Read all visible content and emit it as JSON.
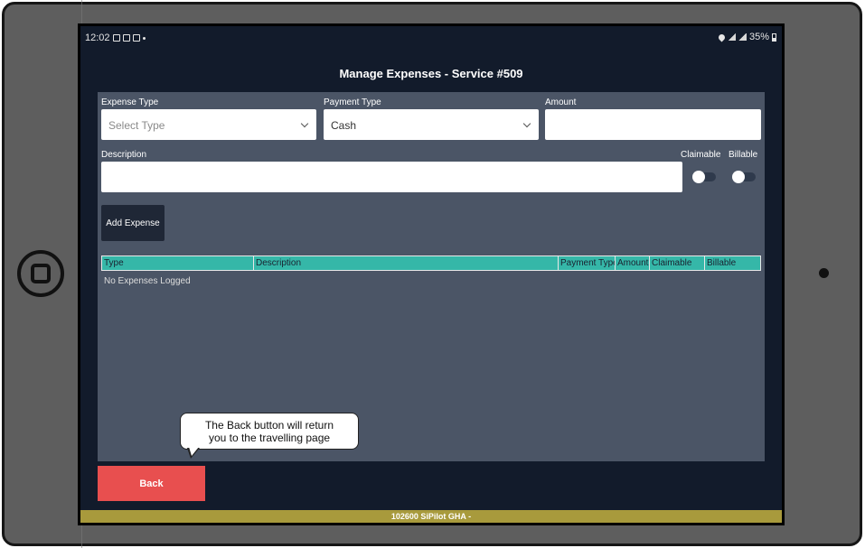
{
  "statusbar": {
    "time": "12:02",
    "battery": "35%"
  },
  "page": {
    "title": "Manage Expenses  -  Service #509"
  },
  "form": {
    "expense_type": {
      "label": "Expense Type",
      "value": "Select Type"
    },
    "payment_type": {
      "label": "Payment Type",
      "value": "Cash"
    },
    "amount": {
      "label": "Amount",
      "value": ""
    },
    "description": {
      "label": "Description",
      "value": ""
    },
    "claimable": {
      "label": "Claimable",
      "on": false
    },
    "billable": {
      "label": "Billable",
      "on": false
    },
    "add_button": "Add Expense"
  },
  "table": {
    "columns": [
      "Type",
      "Description",
      "Payment Type",
      "Amount",
      "Claimable",
      "Billable"
    ],
    "empty_message": "No Expenses Logged"
  },
  "tooltip": {
    "line1": "The Back button will return",
    "line2": "you to the travelling page"
  },
  "back_button": "Back",
  "footer": "102600 SiPilot GHA -"
}
